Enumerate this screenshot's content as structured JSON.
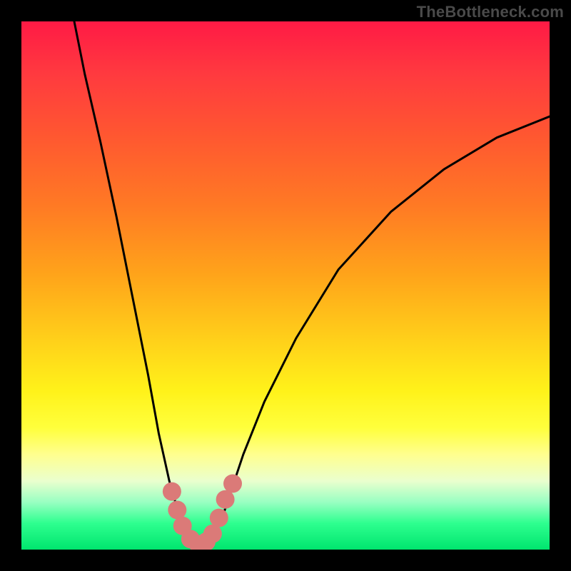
{
  "watermark": "TheBottleneck.com",
  "chart_data": {
    "type": "line",
    "title": "",
    "xlabel": "",
    "ylabel": "",
    "xlim": [
      0,
      100
    ],
    "ylim": [
      0,
      100
    ],
    "series": [
      {
        "name": "bottleneck-curve",
        "x": [
          10,
          12,
          15,
          18,
          21,
          24,
          26,
          28,
          30,
          32,
          33,
          34,
          36,
          38,
          40,
          42,
          46,
          52,
          60,
          70,
          80,
          90,
          100
        ],
        "values": [
          100,
          90,
          77,
          63,
          48,
          33,
          22,
          13,
          6,
          2,
          1,
          1,
          2,
          6,
          12,
          18,
          28,
          40,
          53,
          64,
          72,
          78,
          82
        ]
      }
    ],
    "markers": {
      "name": "highlighted-points",
      "x": [
        28.5,
        29.5,
        30.5,
        32.0,
        33.5,
        35.0,
        36.2,
        37.4,
        38.6,
        40.0
      ],
      "values": [
        11.0,
        7.5,
        4.5,
        2.0,
        1.0,
        1.5,
        3.0,
        6.0,
        9.5,
        12.5
      ]
    },
    "colors": {
      "curve": "#000000",
      "marker_fill": "#db7a78",
      "gradient_top": "#ff1a45",
      "gradient_bottom": "#00e56e"
    }
  }
}
